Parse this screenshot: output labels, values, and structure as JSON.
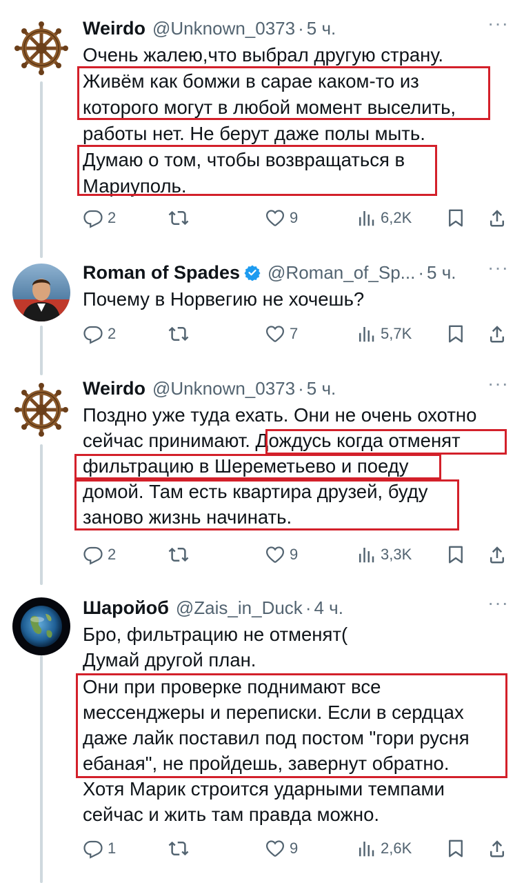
{
  "colors": {
    "text": "#0f1419",
    "secondary": "#536471",
    "verified": "#1d9bf0",
    "highlight": "#d3202a",
    "thread_line": "#cfd9de"
  },
  "tweets": [
    {
      "name": "Weirdo",
      "handle": "@Unknown_0373",
      "time": "5 ч.",
      "more": "···",
      "avatar": "ship-wheel",
      "lines": [
        "Очень жалею,что выбрал другую страну.",
        "Живём как бомжи в сарае каком-то из",
        "которого могут в любой момент выселить,",
        "работы нет. Не берут даже полы мыть.",
        "Думаю о том, чтобы возвращаться в",
        "Мариуполь."
      ],
      "replies": "2",
      "retweets": "",
      "likes": "9",
      "views": "6,2K"
    },
    {
      "name": "Roman of Spades",
      "handle": "@Roman_of_Sp...",
      "time": "5 ч.",
      "more": "···",
      "avatar": "person-photo",
      "verified": true,
      "lines": [
        "Почему в Норвегию не хочешь?"
      ],
      "replies": "2",
      "retweets": "",
      "likes": "7",
      "views": "5,7K"
    },
    {
      "name": "Weirdo",
      "handle": "@Unknown_0373",
      "time": "5 ч.",
      "more": "···",
      "avatar": "ship-wheel",
      "lines": [
        "Поздно уже туда ехать. Они не очень охотно",
        "сейчас принимают. Дождусь когда отменят",
        "фильтрацию в Шереметьево и поеду",
        "домой. Там есть квартира друзей, буду",
        "заново жизнь начинать."
      ],
      "replies": "2",
      "retweets": "",
      "likes": "9",
      "views": "3,3K"
    },
    {
      "name": "Шаройоб",
      "handle": "@Zais_in_Duck",
      "time": "4 ч.",
      "more": "···",
      "avatar": "earth",
      "lines": [
        "Бро, фильтрацию не отменят(",
        "Думай другой план.",
        "Они при проверке поднимают все",
        "мессенджеры и переписки. Если в сердцах",
        "даже лайк поставил под постом \"гори русня",
        "ебаная\", не пройдешь, завернут обратно.",
        "Хотя Марик строится ударными темпами",
        "сейчас и жить там правда можно."
      ],
      "replies": "1",
      "retweets": "",
      "likes": "9",
      "views": "2,6K"
    }
  ]
}
